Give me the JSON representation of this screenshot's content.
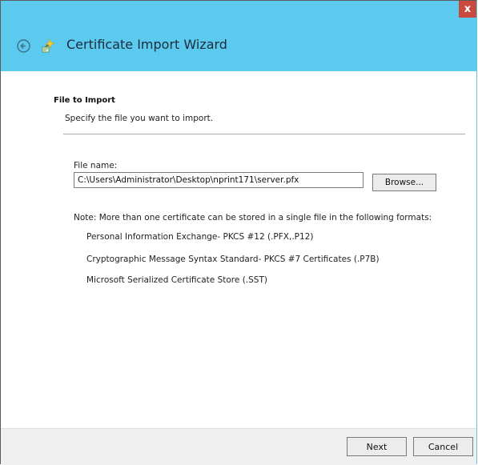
{
  "window": {
    "close_label": "x",
    "title": "Certificate Import Wizard",
    "colors": {
      "titlebar": "#5ccaee",
      "close": "#c94a3c",
      "footer": "#f0f0f0"
    },
    "icons": {
      "back": "back-arrow-circle-icon",
      "wizard": "certificate-wizard-icon",
      "close": "close-icon"
    }
  },
  "section": {
    "heading": "File to Import",
    "subheading": "Specify the file you want to import."
  },
  "file": {
    "label": "File name:",
    "value": "C:\\Users\\Administrator\\Desktop\\nprint171\\server.pfx",
    "browse_label": "Browse..."
  },
  "note": {
    "text": "Note:  More than one certificate can be stored in a single file in the following formats:",
    "formats": [
      "Personal Information Exchange- PKCS #12 (.PFX,.P12)",
      "Cryptographic Message Syntax Standard- PKCS #7 Certificates (.P7B)",
      "Microsoft Serialized Certificate Store (.SST)"
    ]
  },
  "footer": {
    "next_label": "Next",
    "cancel_label": "Cancel"
  }
}
